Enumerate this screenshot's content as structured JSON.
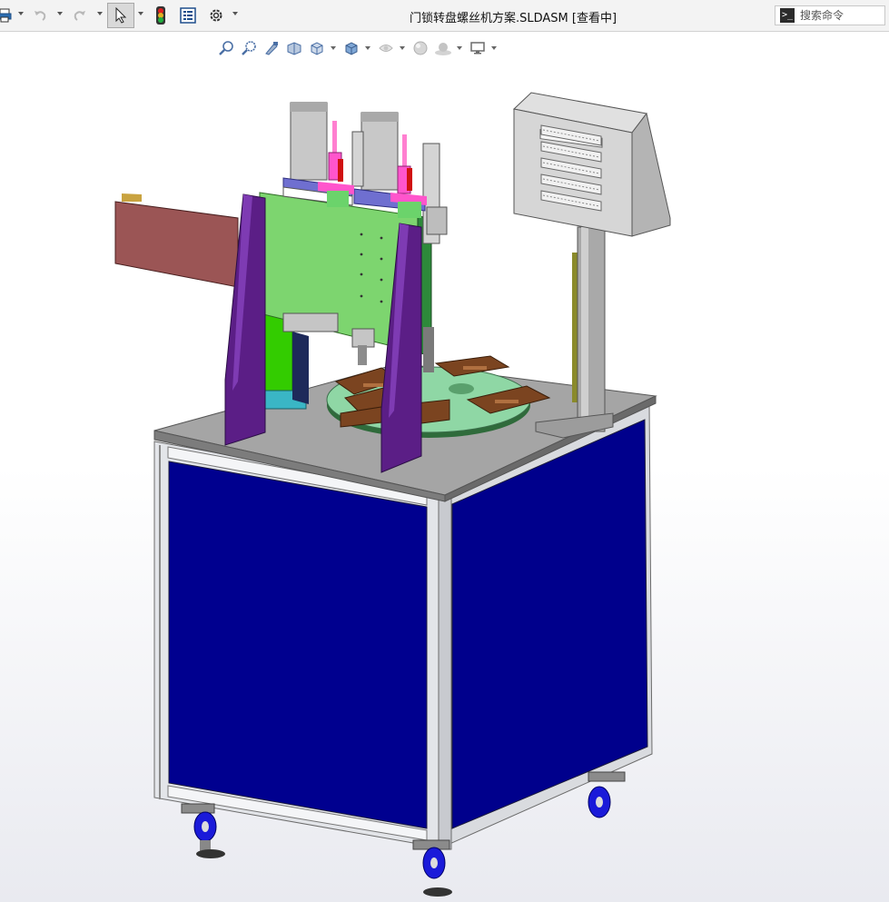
{
  "window": {
    "title": "门锁转盘螺丝机方案.SLDASM [查看中]"
  },
  "toolbar": {
    "items": [
      {
        "name": "print-icon"
      },
      {
        "name": "undo-icon"
      },
      {
        "name": "redo-icon"
      },
      {
        "name": "select-icon"
      },
      {
        "name": "rebuild-traffic-light-icon"
      },
      {
        "name": "file-properties-icon"
      },
      {
        "name": "options-gear-icon"
      }
    ]
  },
  "search": {
    "placeholder": "搜索命令",
    "value": ""
  },
  "view_toolbar": {
    "items": [
      {
        "name": "zoom-to-fit-icon"
      },
      {
        "name": "zoom-to-area-icon"
      },
      {
        "name": "previous-view-icon"
      },
      {
        "name": "section-view-icon"
      },
      {
        "name": "view-orientation-icon"
      },
      {
        "name": "display-style-icon"
      },
      {
        "name": "hide-show-items-icon"
      },
      {
        "name": "edit-appearance-icon"
      },
      {
        "name": "apply-scene-icon"
      },
      {
        "name": "view-settings-icon"
      }
    ]
  },
  "colors": {
    "panel_blue": "#00008f",
    "frame_silver": "#d6d8dc",
    "plate_green": "#7dd56f",
    "upright_purple": "#5b1e86",
    "arm_red": "#9b5555",
    "turntable_green": "#8fd7a5",
    "fixture_brown": "#7b4420",
    "top_plate_gray": "#9a9a9a",
    "wheel_blue": "#1a1ad9"
  }
}
